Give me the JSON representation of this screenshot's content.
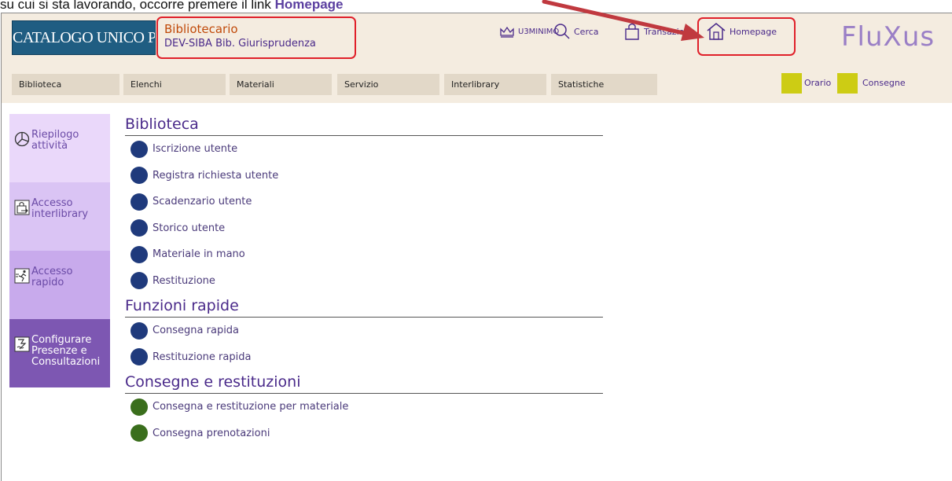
{
  "instruction": {
    "text": "su cui si sta lavorando, occorre premere il link ",
    "link": "Homepage"
  },
  "header": {
    "logo": "CATALOGO UNICO PAVESE",
    "user_role": "Bibliotecario",
    "user_library": "DEV-SIBA Bib. Giurisprudenza",
    "nav": {
      "login": "U3MINIMO",
      "cerca": "Cerca",
      "transazione": "Transazione",
      "homepage": "Homepage"
    },
    "brand": "FluXus"
  },
  "menubar": {
    "items": [
      "Biblioteca",
      "Elenchi",
      "Materiali",
      "Servizio",
      "Interlibrary",
      "Statistiche"
    ],
    "orario": "Orario",
    "consegne": "Consegne"
  },
  "sidebar": {
    "items": [
      {
        "label": "Riepilogo attività",
        "icon": "pie-chart-icon"
      },
      {
        "label": "Accesso interlibrary",
        "icon": "bag-arrow-icon"
      },
      {
        "label": "Accesso rapido",
        "icon": "runner-icon"
      },
      {
        "label": "Configurare Presenze e Consultazioni",
        "icon": "configure-icon"
      }
    ]
  },
  "sections": [
    {
      "title": "Biblioteca",
      "items": [
        "Iscrizione utente",
        "Registra richiesta utente",
        "Scadenzario utente",
        "Storico utente",
        "Materiale in mano",
        "Restituzione"
      ]
    },
    {
      "title": "Funzioni rapide",
      "items": [
        "Consegna rapida",
        "Restituzione rapida"
      ]
    },
    {
      "title": "Consegne e restituzioni",
      "items": [
        "Consegna e restituzione per materiale",
        "Consegna prenotazioni"
      ]
    }
  ],
  "colors": {
    "accent_red": "#e0202a",
    "purple_text": "#4a2a8a",
    "dot_blue": "#1f3a7c",
    "dot_green": "#3a6e1c",
    "header_bg": "#f4ece0"
  }
}
